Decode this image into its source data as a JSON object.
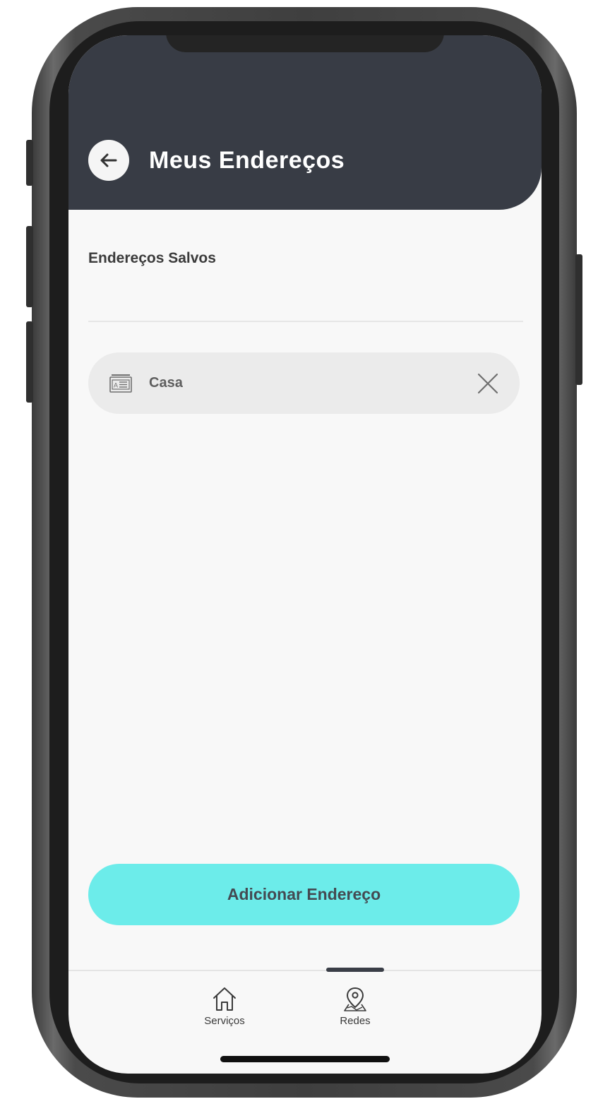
{
  "header": {
    "title": "Meus Endereços",
    "back_icon": "arrow-left-icon",
    "background_color": "#383c45"
  },
  "saved_addresses": {
    "section_title": "Endereços Salvos",
    "items": [
      {
        "label": "Casa",
        "icon": "address-card-icon",
        "remove_icon": "close-icon"
      }
    ]
  },
  "actions": {
    "add_address_label": "Adicionar Endereço",
    "add_address_color": "#6cecea"
  },
  "tab_bar": {
    "tabs": [
      {
        "label": "Serviços",
        "icon": "home-icon"
      },
      {
        "label": "Redes",
        "icon": "map-pin-icon",
        "active": true
      }
    ]
  }
}
